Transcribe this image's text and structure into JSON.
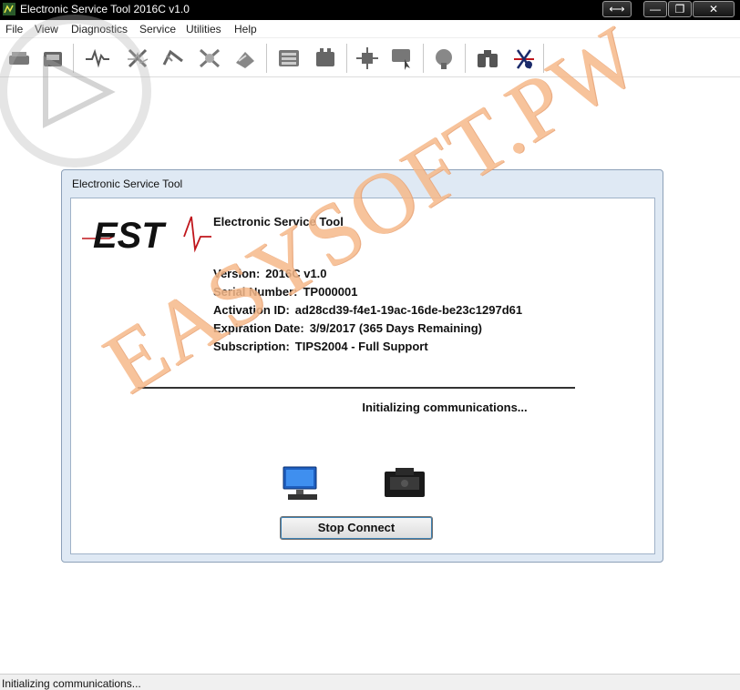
{
  "window": {
    "title": "Electronic Service Tool 2016C v1.0",
    "controls": {
      "pin": "⟷",
      "minimize": "—",
      "maximize": "❐",
      "close": "✕"
    }
  },
  "menu": [
    {
      "label": "File"
    },
    {
      "label": "View"
    },
    {
      "label": "Diagnostics"
    },
    {
      "label": "Service"
    },
    {
      "label": "Utilities"
    },
    {
      "label": "Help"
    }
  ],
  "toolbar": {
    "icons": [
      "connect-icon",
      "ecm-summary-icon",
      "status-icon",
      "active-diagnostic-icon",
      "logged-diagnostic-icon",
      "events-icon",
      "clear-events-icon",
      "configuration-icon",
      "data-link-icon",
      "flash-icon",
      "copy-configuration-icon",
      "report-icon",
      "binoculars-icon",
      "help-icon"
    ]
  },
  "dialog": {
    "title": "Electronic Service Tool",
    "logo_text": "EST",
    "heading": "Electronic Service Tool",
    "fields": [
      {
        "label": "Version:",
        "value": "2016C v1.0"
      },
      {
        "label": "Serial Number:",
        "value": "TP000001"
      },
      {
        "label": "Activation ID:",
        "value": "ad28cd39-f4e1-19ac-16de-be23c1297d61"
      },
      {
        "label": "Expiration Date:",
        "value": "3/9/2017 (365 Days Remaining)"
      },
      {
        "label": "Subscription:",
        "value": "TIPS2004 - Full Support"
      }
    ],
    "status": "Initializing communications...",
    "stop_button": "Stop Connect"
  },
  "watermark": "EASYSOFT.PW",
  "statusbar": {
    "text": "Initializing communications..."
  },
  "colors": {
    "titlebar": "#000000",
    "dialog_bg": "#dfe9f4",
    "watermark": "#f6b98a",
    "logo_accent": "#c0161c"
  }
}
